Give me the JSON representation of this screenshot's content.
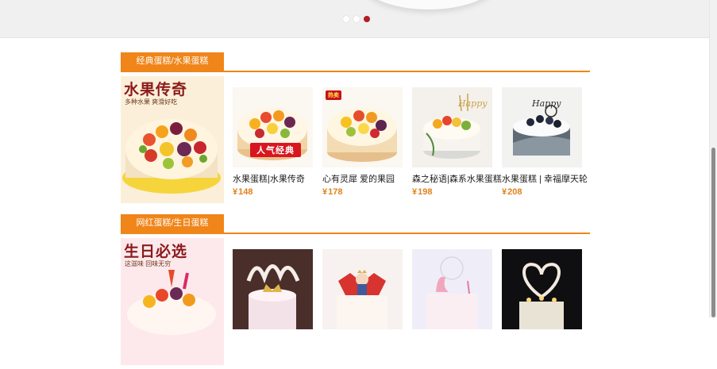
{
  "carousel": {
    "dot_count": 3,
    "active_index": 2
  },
  "sections": [
    {
      "tab_label": "经典蛋糕/水果蛋糕",
      "promo": {
        "title": "水果传奇",
        "subtitle": "多种水果  爽滑好吃"
      },
      "products": [
        {
          "name": "水果蛋糕|水果传奇",
          "currency": "¥",
          "price": "148",
          "badge": "人气经典"
        },
        {
          "name": "心有灵犀 爱的果园",
          "currency": "¥",
          "price": "178",
          "tag": "热卖"
        },
        {
          "name": "森之秘语|森系水果蛋糕",
          "currency": "¥",
          "price": "198"
        },
        {
          "name": "水果蛋糕 | 幸福摩天轮",
          "currency": "¥",
          "price": "208"
        }
      ]
    },
    {
      "tab_label": "网红蛋糕/生日蛋糕",
      "promo": {
        "title": "生日必选",
        "subtitle": "这滋味  回味无穷"
      },
      "products": [
        {
          "name": "",
          "currency": "",
          "price": ""
        },
        {
          "name": "",
          "currency": "",
          "price": ""
        },
        {
          "name": "",
          "currency": "",
          "price": ""
        },
        {
          "name": "",
          "currency": "",
          "price": ""
        }
      ]
    }
  ]
}
